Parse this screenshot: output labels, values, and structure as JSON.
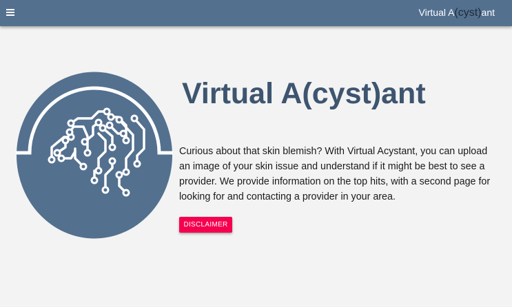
{
  "navbar": {
    "menu_icon": "hamburger-menu-icon",
    "brand_prefix": "Virtual A",
    "brand_middle": "(cyst)",
    "brand_suffix": "ant"
  },
  "hero": {
    "logo_icon": "brain-circuit-icon",
    "title": "Virtual A(cyst)ant",
    "description": "Curious about that skin blemish? With Virtual Acystant, you can upload an image of your skin issue and understand if it might be best to see a provider. We provide information on the top hits, with a second page for looking for and contacting a provider in your area.",
    "disclaimer_label": "DISCLAIMER"
  },
  "colors": {
    "navbar": "#53708f",
    "title": "#3e5570",
    "logo": "#53708f",
    "button": "#f5004f",
    "background": "#f3f3f3"
  }
}
